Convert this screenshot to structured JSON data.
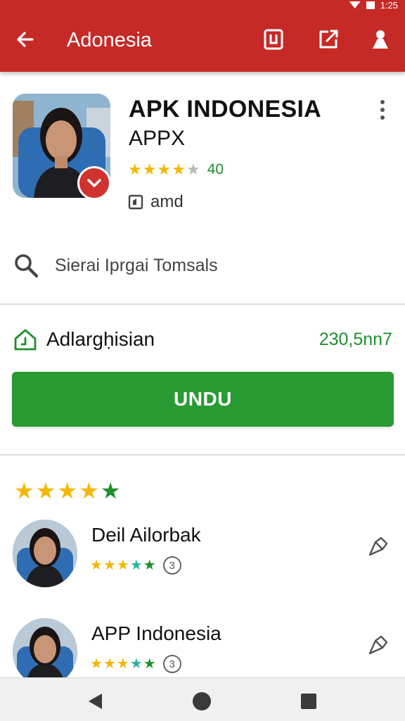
{
  "status_bar": {
    "time": "1:25"
  },
  "app_bar": {
    "title": "Adonesia"
  },
  "app": {
    "name": "APK INDONESIA",
    "subtitle": "APPX",
    "rating_count": "40",
    "rating_stars": 4,
    "developer": "amd"
  },
  "search": {
    "placeholder": "Sierai Iprgai Tomsals"
  },
  "download": {
    "category": "Adlargḥisian",
    "size": "230,5nn7",
    "button_label": "UNDU"
  },
  "reviews": {
    "overall_stars": 5,
    "items": [
      {
        "name": "Deil Ailorbak",
        "stars": 5,
        "count": "3"
      },
      {
        "name": "APP Indonesia",
        "stars": 5,
        "count": "3"
      }
    ]
  },
  "colors": {
    "app_bar": "#c62a27",
    "accent_green": "#2a9a33",
    "star_gold": "#f2b705",
    "star_green": "#1f8f2c"
  }
}
